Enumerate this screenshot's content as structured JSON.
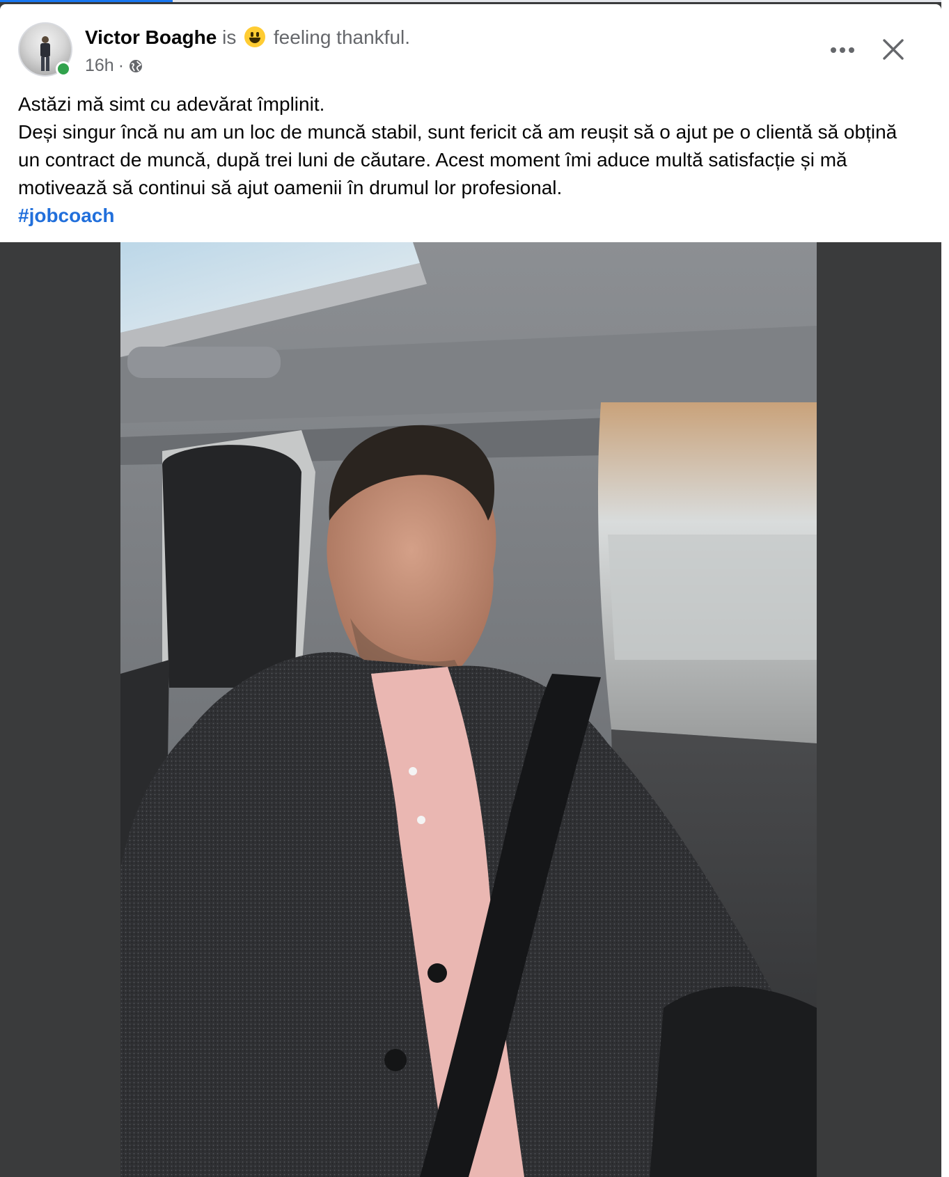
{
  "post": {
    "author_name": "Victor Boaghe",
    "activity_prefix": "is",
    "activity_emoji": "grinning-face-emoji",
    "activity_text": "feeling thankful.",
    "time": "16h",
    "separator": "·",
    "audience_icon": "globe-icon"
  },
  "body": {
    "line1": "Astăzi mă simt cu adevărat împlinit.",
    "line2": "Deși singur încă nu am un loc de muncă stabil, sunt fericit că am reușit să o ajut pe o clientă să obțină un contract de muncă, după trei luni de căutare. Acest moment îmi aduce multă satisfacție și mă motivează să continui să ajut oamenii în drumul lor profesional.",
    "hashtag": "#jobcoach"
  },
  "controls": {
    "more_icon": "more-options-icon",
    "close_icon": "close-icon"
  },
  "colors": {
    "accent": "#1877f2",
    "hashtag": "#216fdb",
    "online": "#31a24c",
    "backdrop": "#3a3b3c"
  }
}
